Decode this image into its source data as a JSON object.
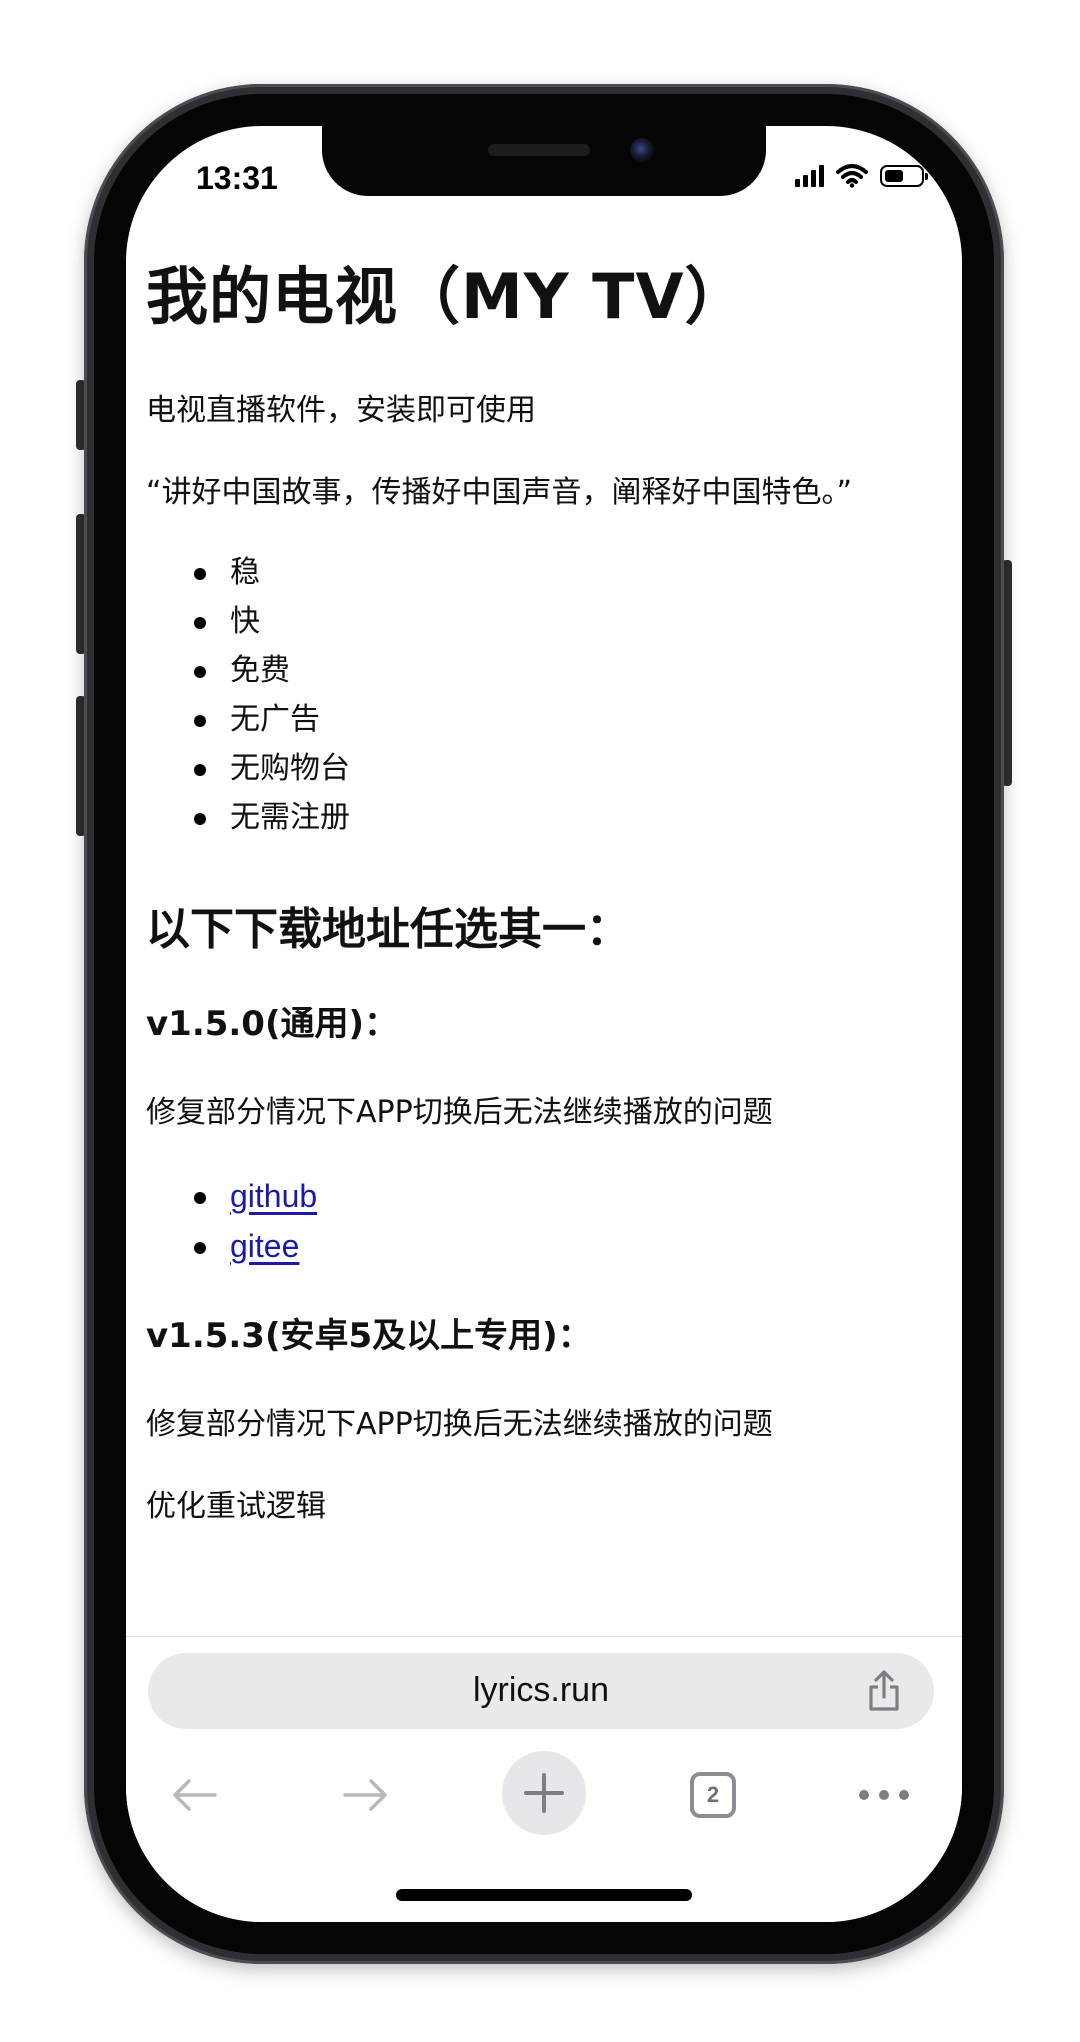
{
  "status_bar": {
    "time": "13:31"
  },
  "page": {
    "title": "我的电视（MY TV）",
    "intro": "电视直播软件，安装即可使用",
    "quote": "“讲好中国故事，传播好中国声音，阐释好中国特色。”",
    "features": [
      "稳",
      "快",
      "免费",
      "无广告",
      "无购物台",
      "无需注册"
    ],
    "download_heading": "以下下载地址任选其一：",
    "versions": [
      {
        "heading": "v1.5.0(通用)：",
        "notes": [
          "修复部分情况下APP切换后无法继续播放的问题"
        ],
        "links": [
          "github",
          "gitee"
        ]
      },
      {
        "heading": "v1.5.3(安卓5及以上专用)：",
        "notes": [
          "修复部分情况下APP切换后无法继续播放的问题",
          "优化重试逻辑"
        ]
      }
    ]
  },
  "browser": {
    "url": "lyrics.run",
    "tab_count": "2",
    "icons": {
      "share": "share-icon",
      "back": "back-arrow-icon",
      "forward": "forward-arrow-icon",
      "new_tab": "plus-icon",
      "tabs": "tabs-icon",
      "more": "more-icon"
    }
  },
  "colors": {
    "link": "#1a1aa8",
    "url_bar_bg": "#e8e9eb",
    "toolbar_icon": "#8a8d93"
  }
}
